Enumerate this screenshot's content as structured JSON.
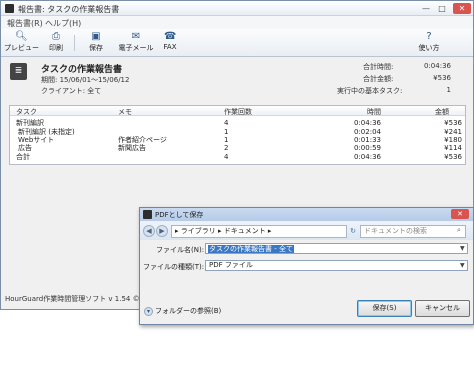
{
  "main_window": {
    "title": "報告書: タスクの作業報告書",
    "controls": {
      "minimize": "—",
      "maximize": "□",
      "close": "✕"
    }
  },
  "menu": {
    "report": "報告書(R)",
    "help": "ヘルプ(H)"
  },
  "toolbar": {
    "preview": "プレビュー",
    "print": "印刷",
    "save": "保存",
    "email": "電子メール",
    "fax": "FAX",
    "howto": "使い方"
  },
  "report": {
    "title": "タスクの作業報告書",
    "period": "期間: 15/06/01〜15/06/12",
    "client": "クライアント: 全て",
    "summary": [
      {
        "label": "合計時間:",
        "value": "0:04:36"
      },
      {
        "label": "合計金額:",
        "value": "¥536"
      },
      {
        "label": "実行中の基本タスク:",
        "value": "1"
      }
    ]
  },
  "table": {
    "headers": {
      "task": "タスク",
      "memo": "メモ",
      "count": "作業回数",
      "time": "時間",
      "amount": "金額"
    },
    "rows": [
      {
        "task": "新刊編訳",
        "memo": "",
        "count": "4",
        "time": "0:04:36",
        "amount": "¥536",
        "level": 0
      },
      {
        "task": "新刊編訳 (未指定)",
        "memo": "",
        "count": "1",
        "time": "0:02:04",
        "amount": "¥241",
        "level": 1
      },
      {
        "task": "Webサイト",
        "memo": "作者紹介ページ",
        "count": "1",
        "time": "0:01:33",
        "amount": "¥180",
        "level": 1
      },
      {
        "task": "広告",
        "memo": "新聞広告",
        "count": "2",
        "time": "0:00:59",
        "amount": "¥114",
        "level": 1
      },
      {
        "task": "合計",
        "memo": "",
        "count": "4",
        "time": "0:04:36",
        "amount": "¥536",
        "level": 0
      }
    ]
  },
  "status_bar": {
    "text": "HourGuard作業時間管理ソフト v 1.54 ©"
  },
  "save_dialog": {
    "title": "PDFとして保存",
    "breadcrumb": "▸ ライブラリ ▸ ドキュメント ▸",
    "search_placeholder": "ドキュメントの検索",
    "filename_label": "ファイル名(N):",
    "filename_value": "タスクの作業報告書 - 全て",
    "filetype_label": "ファイルの種類(T):",
    "filetype_value": "PDF ファイル",
    "folder_toggle": "フォルダーの参照(B)",
    "save_button": "保存(S)",
    "cancel_button": "キャンセル"
  }
}
